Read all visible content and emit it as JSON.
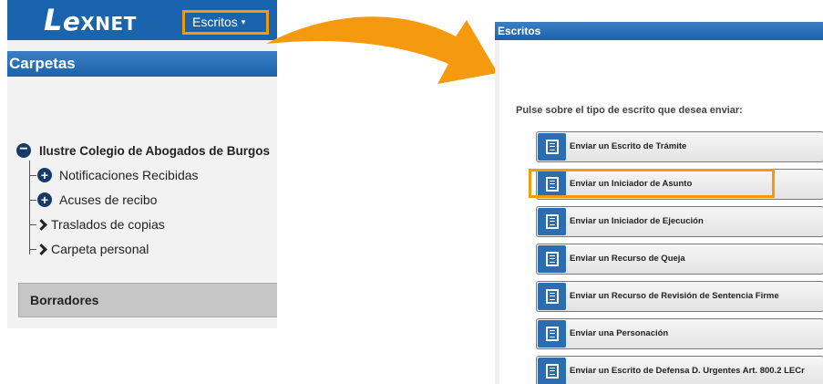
{
  "left": {
    "logo": {
      "part1": "L",
      "part2": "e",
      "part3": "XNET"
    },
    "menu": {
      "escritos_label": "Escritos",
      "caret": "▾"
    },
    "carpetas_header": "Carpetas",
    "tree": {
      "root": "Ilustre Colegio de Abogados de Burgos",
      "items": [
        {
          "label": "Notificaciones Recibidas",
          "icon": "plus-circle-icon"
        },
        {
          "label": "Acuses de recibo",
          "icon": "plus-circle-icon"
        },
        {
          "label": "Traslados de copias",
          "icon": "chevron-right-icon"
        },
        {
          "label": "Carpeta personal",
          "icon": "chevron-right-icon"
        }
      ]
    },
    "borradores": "Borradores"
  },
  "right": {
    "header": "Escritos",
    "instruction": "Pulse sobre el tipo de escrito que desea enviar:",
    "buttons": [
      "Enviar un Escrito de Trámite",
      "Enviar un Iniciador de Asunto",
      "Enviar un Iniciador de Ejecución",
      "Enviar un Recurso de Queja",
      "Enviar un Recurso de Revisión de Sentencia Firme",
      "Enviar una Personación",
      "Enviar un Escrito de Defensa D. Urgentes Art. 800.2 LECr"
    ]
  },
  "colors": {
    "header_blue": "#1a63ad",
    "highlight_orange": "#f59a0e",
    "icon_blue": "#2c6db1",
    "tree_icon_navy": "#183a68"
  }
}
